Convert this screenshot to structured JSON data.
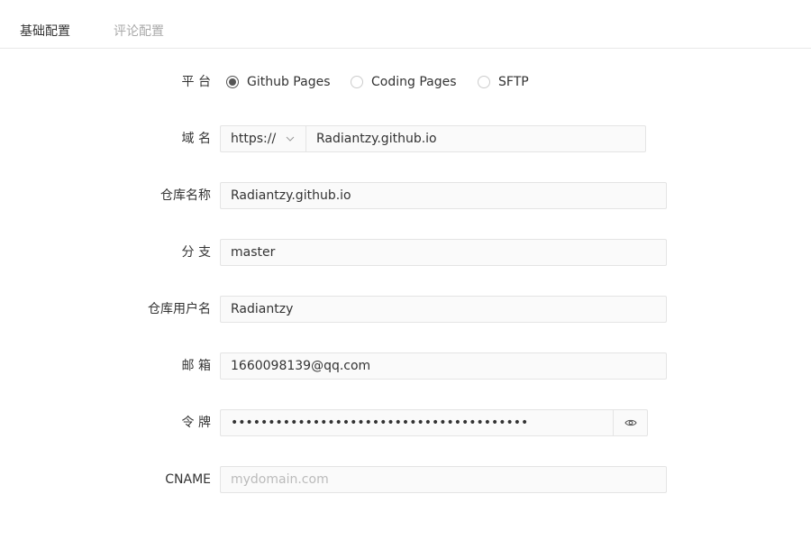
{
  "tabs": {
    "basic": "基础配置",
    "comments": "评论配置"
  },
  "form": {
    "platform": {
      "label": "平 台",
      "options": [
        "Github Pages",
        "Coding Pages",
        "SFTP"
      ],
      "selected": "Github Pages"
    },
    "domain": {
      "label": "域 名",
      "protocol": "https://",
      "value": "Radiantzy.github.io"
    },
    "repo": {
      "label": "仓库名称",
      "value": "Radiantzy.github.io"
    },
    "branch": {
      "label": "分 支",
      "value": "master"
    },
    "username": {
      "label": "仓库用户名",
      "value": "Radiantzy"
    },
    "email": {
      "label": "邮 箱",
      "value": "1660098139@qq.com"
    },
    "token": {
      "label": "令 牌",
      "masked": "••••••••••••••••••••••••••••••••••••••••"
    },
    "cname": {
      "label": "CNAME",
      "placeholder": "mydomain.com"
    }
  },
  "icons": {
    "chevron": "chevron-down-icon",
    "eye": "eye-icon"
  }
}
